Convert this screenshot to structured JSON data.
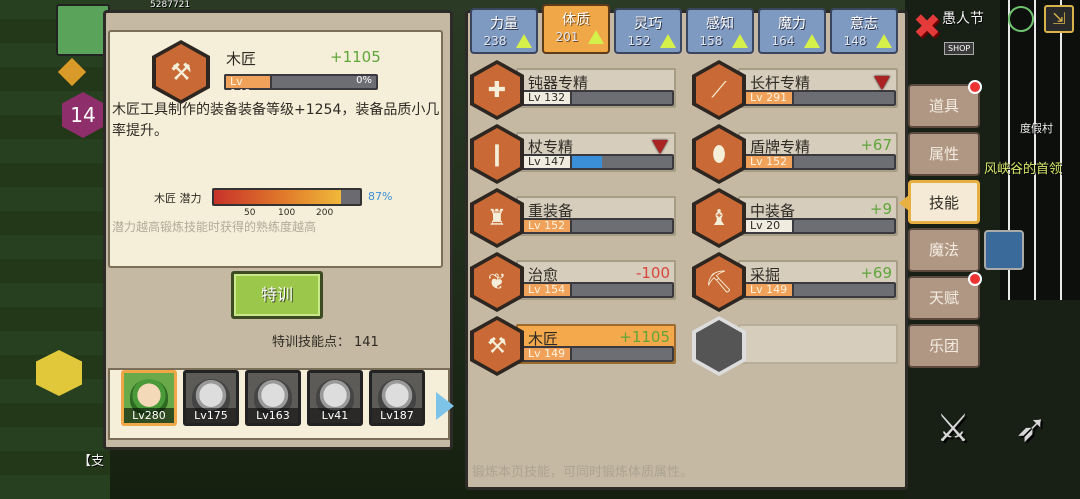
{
  "hud": {
    "player_count": "5287721",
    "level_badge": "14",
    "shop_sign": "SHOP",
    "village": "度假村",
    "festival": "愚人节",
    "boss_hint": "风峡谷的首领",
    "support_label": "【支"
  },
  "skill_detail": {
    "name": "木匠",
    "bonus": "+1105",
    "level": "Lv 149",
    "progress_text": "0%",
    "progress": 0,
    "description": "木匠工具制作的装备装备等级+1254，装备品质小几率提升。",
    "potential_label": "木匠 潜力",
    "potential_percent": "87%",
    "potential": 0.87,
    "potential_ticks": [
      "50",
      "100",
      "200"
    ],
    "potential_hint": "潜力越高锻炼技能时获得的熟练度越高",
    "train_button": "特训",
    "train_points_label": "特训技能点：",
    "train_points": "141"
  },
  "characters": [
    {
      "lv": "Lv280",
      "selected": true
    },
    {
      "lv": "Lv175",
      "selected": false
    },
    {
      "lv": "Lv163",
      "selected": false
    },
    {
      "lv": "Lv41",
      "selected": false
    },
    {
      "lv": "Lv187",
      "selected": false
    }
  ],
  "stat_tabs": [
    {
      "label": "力量",
      "value": "238"
    },
    {
      "label": "体质",
      "value": "201",
      "active": true
    },
    {
      "label": "灵巧",
      "value": "152"
    },
    {
      "label": "感知",
      "value": "158"
    },
    {
      "label": "魔力",
      "value": "164"
    },
    {
      "label": "意志",
      "value": "148"
    }
  ],
  "skills": [
    {
      "name": "钝器专精",
      "level": "Lv 132",
      "bonus": "",
      "lvstyle": "white",
      "progress": 0,
      "icon": "hammer-icon"
    },
    {
      "name": "长杆专精",
      "level": "Lv 291",
      "bonus": "",
      "lvstyle": "orange",
      "progress": 0,
      "down": true,
      "icon": "spear-icon"
    },
    {
      "name": "杖专精",
      "level": "Lv 147",
      "bonus": "",
      "lvstyle": "white",
      "progress": 0.3,
      "down": true,
      "icon": "staff-icon"
    },
    {
      "name": "盾牌专精",
      "level": "Lv 152",
      "bonus": "+67",
      "lvstyle": "orange",
      "progress": 0,
      "icon": "shield-icon"
    },
    {
      "name": "重装备",
      "level": "Lv 152",
      "bonus": "",
      "lvstyle": "orange",
      "progress": 0,
      "icon": "heavy-armor-icon"
    },
    {
      "name": "中装备",
      "level": "Lv 20",
      "bonus": "+9",
      "lvstyle": "white",
      "progress": 0,
      "icon": "medium-armor-icon"
    },
    {
      "name": "治愈",
      "level": "Lv 154",
      "bonus": "-100",
      "lvstyle": "orange",
      "progress": 0,
      "icon": "heal-icon"
    },
    {
      "name": "采掘",
      "level": "Lv 149",
      "bonus": "+69",
      "lvstyle": "orange",
      "progress": 0,
      "icon": "pickaxe-icon"
    },
    {
      "name": "木匠",
      "level": "Lv 149",
      "bonus": "+1105",
      "lvstyle": "orange",
      "progress": 0,
      "selected": true,
      "icon": "saw-icon"
    }
  ],
  "footer_hint": "锻炼本页技能，可同时锻炼体质属性。",
  "side_menu": [
    {
      "label": "道具",
      "dot": true
    },
    {
      "label": "属性",
      "dot": false
    },
    {
      "label": "技能",
      "dot": false,
      "active": true
    },
    {
      "label": "魔法",
      "dot": false
    },
    {
      "label": "天赋",
      "dot": true
    },
    {
      "label": "乐团",
      "dot": false
    }
  ],
  "colors": {
    "accent_orange": "#f0a748",
    "positive": "#5fa53a",
    "negative": "#d8463c",
    "potential_blue": "#3a8fd8"
  }
}
